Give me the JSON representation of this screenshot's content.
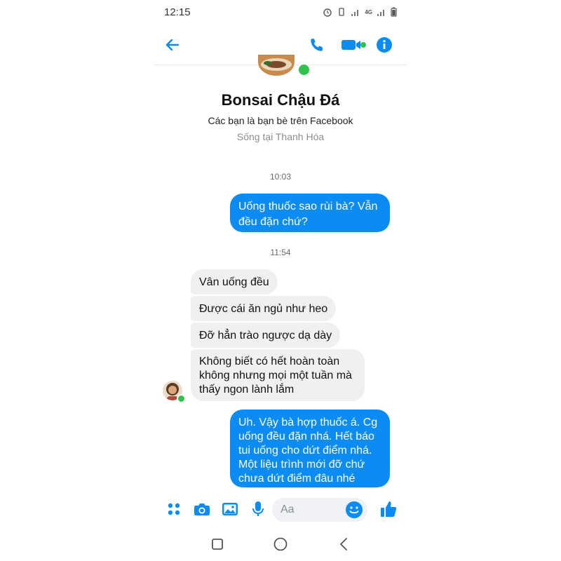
{
  "status_bar": {
    "time": "12:15",
    "network_label": "4G"
  },
  "header": {
    "back_icon": "arrow-left-icon",
    "call_icon": "phone-icon",
    "video_icon": "video-camera-icon",
    "info_icon": "info-icon"
  },
  "profile": {
    "name": "Bonsai Chậu Đá",
    "relation": "Các bạn là bạn bè trên Facebook",
    "location": "Sống tại Thanh Hóa"
  },
  "messages": {
    "time_1": "10:03",
    "out_1": [
      "Uống thuốc sao rùi bà? Vẫn",
      "đều đặn chứ?"
    ],
    "time_2": "11:54",
    "in_1": "Vân uống đều",
    "in_2": "Được cái ăn ngủ như heo",
    "in_3": "Đỡ hẳn trào ngược dạ dày",
    "in_4": [
      "Không biết có hết hoàn toàn",
      "không nhưng mọi một tuần mà",
      "thấy ngon lành lắm"
    ],
    "out_2": [
      "Uh. Vậy bà hợp thuốc á. Cg",
      "uống đều đặn nhá. Hết báo",
      "tui uống cho dứt điểm nhá.",
      "Một liệu trình mới đỡ chứ",
      "chưa dứt điểm đâu nhé"
    ]
  },
  "composer": {
    "placeholder": "Aa",
    "icons": [
      "menu-dots-icon",
      "camera-icon",
      "image-icon",
      "microphone-icon",
      "emoji-icon",
      "like-icon"
    ]
  },
  "nav": {
    "icons": [
      "recents-icon",
      "home-icon",
      "back-icon"
    ]
  },
  "colors": {
    "accent": "#0b8cf5",
    "incoming_bubble": "#f0f0f0",
    "online": "#31c24d"
  }
}
